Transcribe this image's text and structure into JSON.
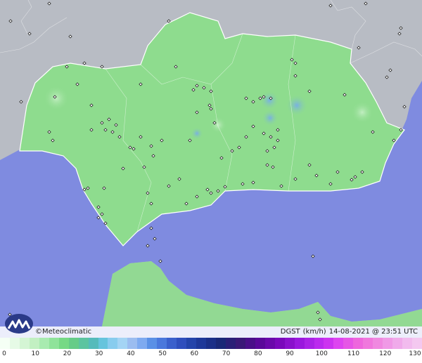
{
  "brand": {
    "copyright": "©",
    "name": "Meteoclimatic"
  },
  "caption": {
    "variable": "DGST",
    "unit": "(km/h)",
    "timestamp": "14-08-2021 @ 23:51 UTC"
  },
  "legend": {
    "ticks": [
      "0",
      "10",
      "20",
      "30",
      "40",
      "50",
      "60",
      "70",
      "80",
      "90",
      "100",
      "110",
      "120",
      "130"
    ],
    "colors": [
      "#f5fff5",
      "#e6fae6",
      "#d4f5d4",
      "#c2f0c2",
      "#a8ebb0",
      "#8fe39a",
      "#76d985",
      "#66cc88",
      "#5cc4a0",
      "#55bbbb",
      "#66c4dd",
      "#88ccee",
      "#a4d4f4",
      "#9bbdf0",
      "#7eaaf0",
      "#5a90e6",
      "#4a78dc",
      "#3a60cc",
      "#2f4fbd",
      "#2444aa",
      "#1e3899",
      "#1b2f88",
      "#1a2877",
      "#2a1f77",
      "#3a1877",
      "#4a0f88",
      "#5a0899",
      "#6a08aa",
      "#7a08bb",
      "#8a10cc",
      "#9a18dd",
      "#aa22e6",
      "#bb2aee",
      "#cc33f0",
      "#dd44f0",
      "#e655e6",
      "#ee66dd",
      "#f077dd",
      "#f088e0",
      "#f099e6",
      "#f0aaea",
      "#f2bbee",
      "#f4c8f0"
    ]
  },
  "colors": {
    "sea": "#7f8be0",
    "land_grey": "#b8bcc4",
    "land_green": "#8edc8e",
    "border": "#ffffff"
  }
}
